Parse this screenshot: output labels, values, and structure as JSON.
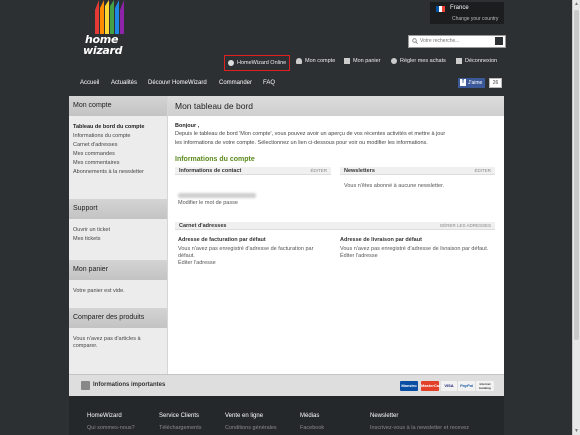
{
  "brand": {
    "line1": "home",
    "line2": "wizard"
  },
  "country": {
    "name": "France",
    "change": "Change your country"
  },
  "search": {
    "placeholder": "Votre recherche..."
  },
  "top_links": [
    {
      "label": "HomeWizard Online",
      "icon": "globe-icon"
    },
    {
      "label": "Mon compte",
      "icon": "user-icon"
    },
    {
      "label": "Mon panier",
      "icon": "cart-icon"
    },
    {
      "label": "Régler mes achats",
      "icon": "checkout-icon"
    },
    {
      "label": "Déconnexion",
      "icon": "lock-icon"
    }
  ],
  "main_nav": [
    "Accueil",
    "Actualités",
    "Découvr HomeWizard",
    "Commander",
    "FAQ"
  ],
  "facebook": {
    "like": "J'aime",
    "count": "26"
  },
  "sidebar": {
    "account": {
      "title": "Mon compte",
      "items": [
        "Tableau de bord du compte",
        "Informations du compte",
        "Carnet d'adresses",
        "Mes commandes",
        "Mes commentaires",
        "Abonnements à la newsletter"
      ]
    },
    "support": {
      "title": "Support",
      "items": [
        "Ouvrir un ticket",
        "Mes tickets"
      ]
    },
    "cart": {
      "title": "Mon panier",
      "text": "Votre panier est vide."
    },
    "compare": {
      "title": "Comparer des produits",
      "text_line1": "Vous n'avez pas d'articles à",
      "text_line2": "comparer."
    }
  },
  "main": {
    "title": "Mon tableau de bord",
    "hello": "Bonjour ,",
    "intro_line1": "Depuis le tableau de bord 'Mon compte', vous pouvez avoir un aperçu de vos récentes activités et mettre à jour",
    "intro_line2": "les informations de votre compte. Sélectionnez un lien ci-dessous pour voir ou modifier les informations.",
    "account_info_heading": "Informations du compte",
    "contact": {
      "title": "Informations de contact",
      "edit": "ÉDITER",
      "change_password": "Modifier le mot de passe"
    },
    "newsletters": {
      "title": "Newsletters",
      "edit": "ÉDITER",
      "text": "Vous n'êtes abonné à aucune newsletter."
    },
    "address_book": {
      "title": "Carnet d'adresses",
      "manage": "GÉRER LES ADRESSES",
      "billing": {
        "title": "Adresse de facturation par défaut",
        "line1": "Vous n'avez pas enregistré d'adresse de facturation par",
        "line2": "défaut.",
        "edit": "Éditer l'adresse"
      },
      "shipping": {
        "title": "Adresse de livraison par défaut",
        "line1": "Vous n'avez pas enregistré d'adresse de livraison par défaut.",
        "edit": "Éditer l'adresse"
      }
    }
  },
  "info_bar": {
    "label": "Informations importantes",
    "payments": [
      "Maestro",
      "MasterCard",
      "VISA",
      "PayPal",
      "internet banking"
    ]
  },
  "footer": {
    "columns": [
      {
        "title": "HomeWizard",
        "sub": "Qui sommes-nous?"
      },
      {
        "title": "Service Clients",
        "sub": "Téléchargements"
      },
      {
        "title": "Vente en ligne",
        "sub": "Conditions générales"
      },
      {
        "title": "Médias",
        "sub": "Facebook"
      },
      {
        "title": "Newsletter",
        "sub": "Inscrivez-vous à la newsletter et recevez"
      }
    ]
  },
  "colors": {
    "page_bg": "#2d3033",
    "accent_green": "#5a8a1c",
    "highlight_red": "#e02020",
    "facebook_blue": "#3b5998"
  }
}
